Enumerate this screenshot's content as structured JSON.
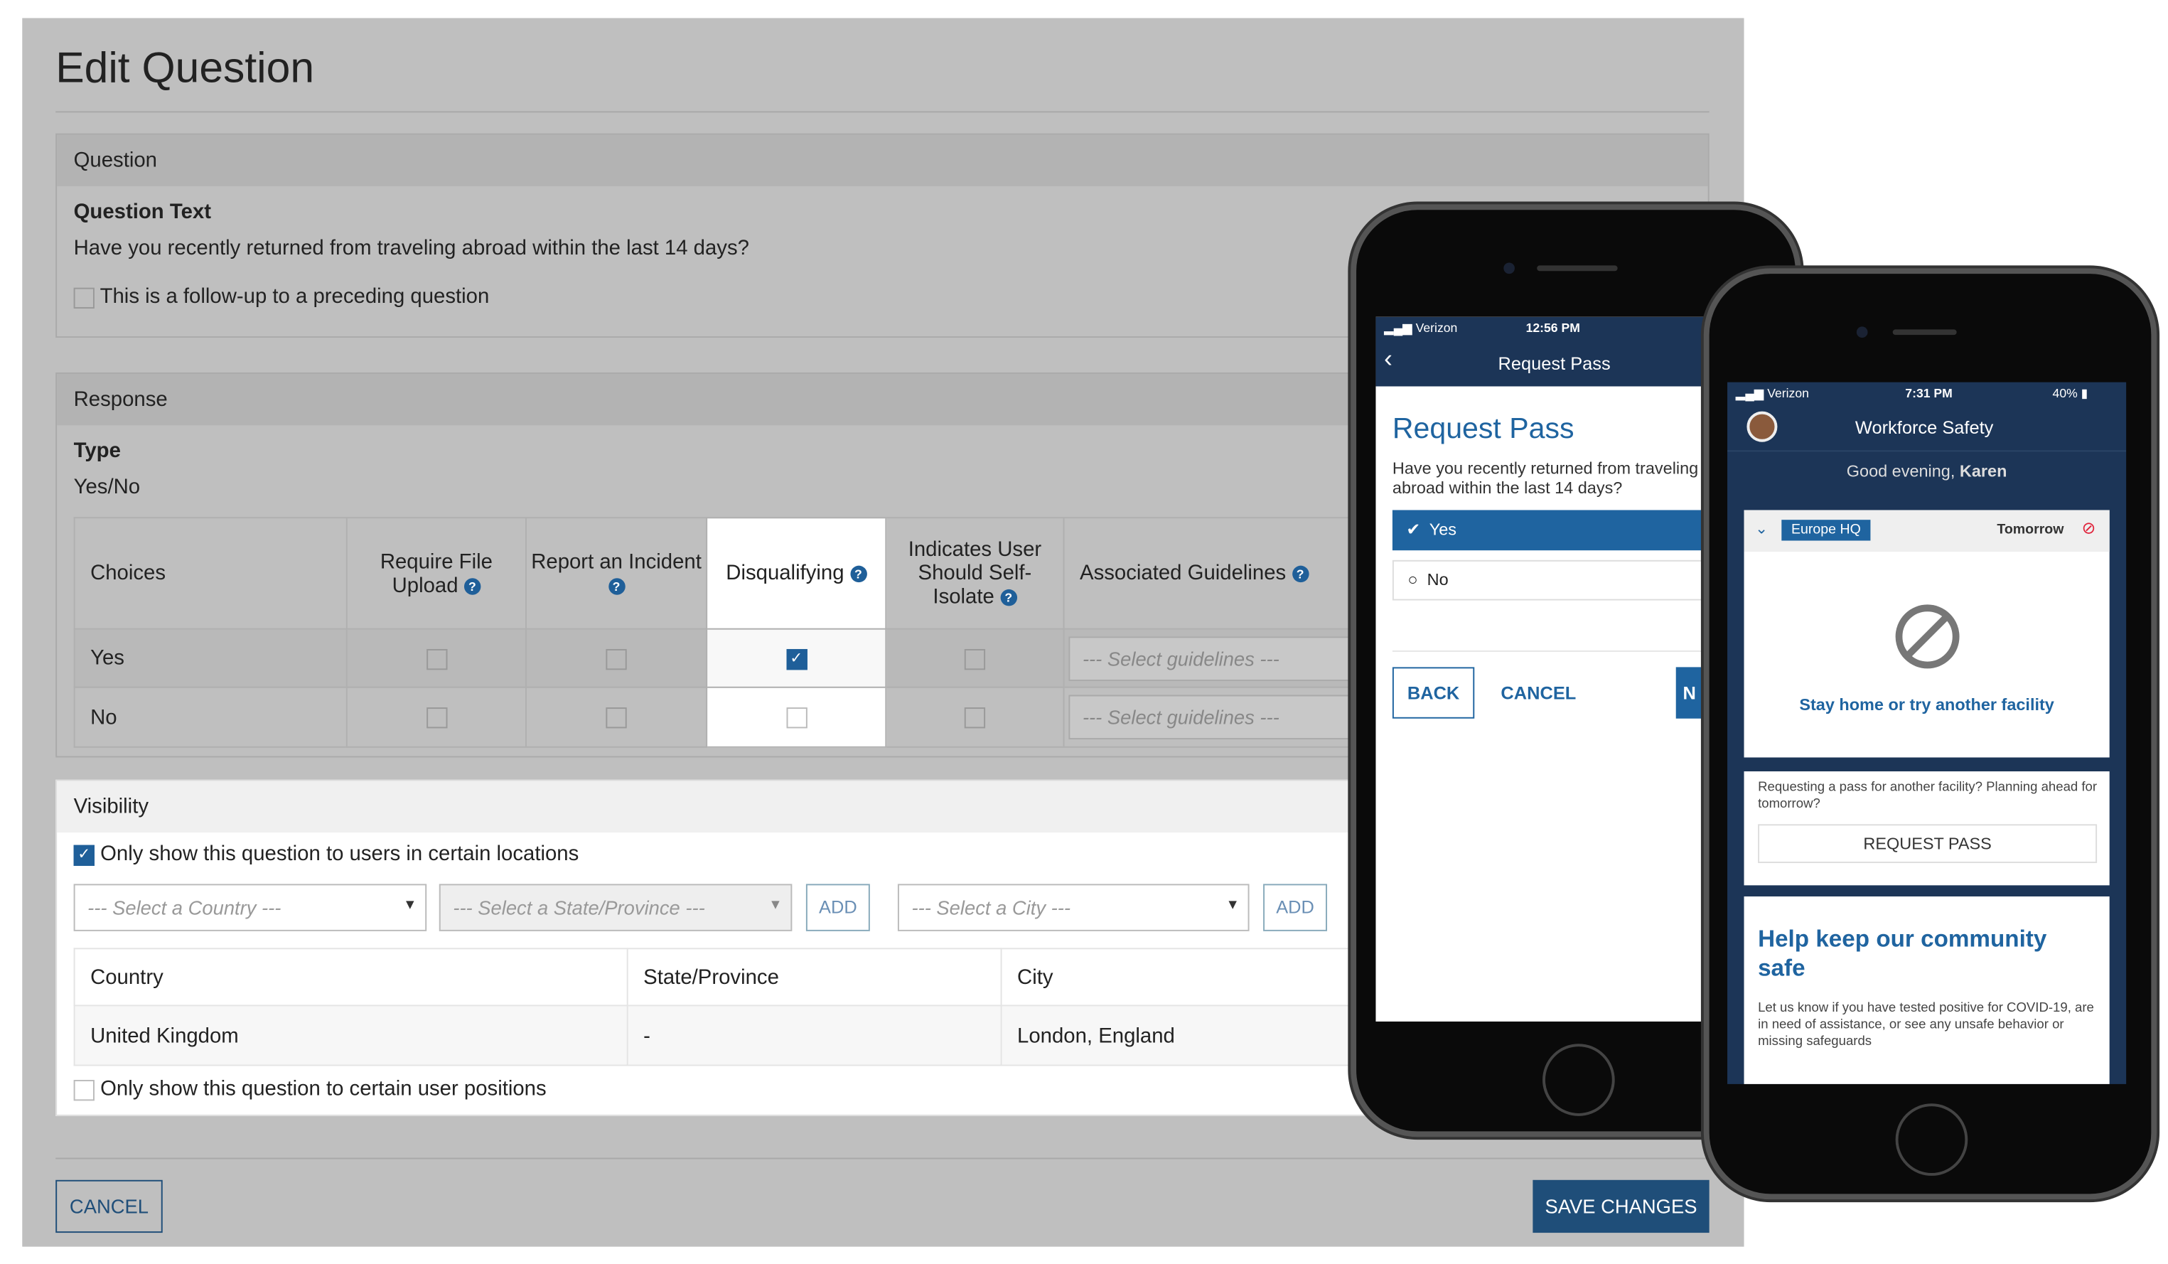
{
  "page_title": "Edit Question",
  "question": {
    "header": "Question",
    "text_label": "Question Text",
    "text": "Have you recently returned from traveling abroad within the last 14 days?",
    "followup_label": "This is a follow-up to a preceding question",
    "followup_checked": false
  },
  "response": {
    "header": "Response",
    "type_label": "Type",
    "type_value": "Yes/No",
    "columns": [
      "Choices",
      "Require File Upload",
      "Report an Incident",
      "Disqualifying",
      "Indicates User Should Self-Isolate",
      "Associated Guidelines"
    ],
    "rows": [
      {
        "choice": "Yes",
        "require_file": false,
        "report_incident": false,
        "disqualifying": true,
        "self_isolate": false,
        "guidelines_placeholder": "--- Select guidelines ---"
      },
      {
        "choice": "No",
        "require_file": false,
        "report_incident": false,
        "disqualifying": false,
        "self_isolate": false,
        "guidelines_placeholder": "--- Select guidelines ---"
      }
    ]
  },
  "visibility": {
    "header": "Visibility",
    "locations_label": "Only show this question to users in certain locations",
    "locations_checked": true,
    "country_placeholder": "--- Select a Country ---",
    "state_placeholder": "--- Select a State/Province ---",
    "city_placeholder": "--- Select a City ---",
    "add_label": "ADD",
    "columns": [
      "Country",
      "State/Province",
      "City"
    ],
    "rows": [
      {
        "country": "United Kingdom",
        "state": "-",
        "city": "London, England"
      }
    ],
    "positions_label": "Only show this question to certain user positions",
    "positions_checked": false
  },
  "footer": {
    "cancel": "CANCEL",
    "save": "SAVE CHANGES"
  },
  "phone1": {
    "carrier": "Verizon",
    "time": "12:56 PM",
    "nav_title": "Request Pass",
    "heading": "Request Pass",
    "question": "Have you recently returned from traveling abroad within the last 14 days?",
    "options": [
      "Yes",
      "No"
    ],
    "selected": "Yes",
    "back": "BACK",
    "cancel": "CANCEL",
    "next": "N"
  },
  "phone2": {
    "carrier": "Verizon",
    "time": "7:31 PM",
    "battery": "40%",
    "app_title": "Workforce Safety",
    "greeting": "Good evening,",
    "user": "Karen",
    "location": "Europe HQ",
    "day": "Tomorrow",
    "status": "Stay home or try another facility",
    "request_prompt": "Requesting a pass for another facility? Planning ahead for tomorrow?",
    "request_button": "REQUEST PASS",
    "help_title": "Help keep our community safe",
    "help_text": "Let us know if you have tested positive for COVID-19, are in need of assistance, or see any unsafe behavior or missing safeguards"
  },
  "colors": {
    "brand_blue": "#1f5f99",
    "navy": "#1c3557",
    "overlay_gray": "#bfbfbf",
    "alert_red": "#e0223a"
  }
}
